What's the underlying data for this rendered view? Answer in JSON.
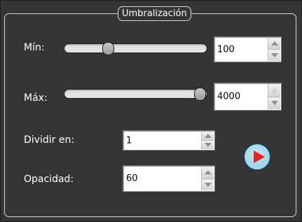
{
  "group": {
    "title": "Umbralización"
  },
  "min": {
    "label": "Mín:",
    "value": "100",
    "up_enabled": true,
    "down_enabled": true
  },
  "max": {
    "label": "Máx:",
    "value": "4000",
    "up_enabled": false,
    "down_enabled": true
  },
  "divide": {
    "label": "Dividir en:",
    "value": "1",
    "up_enabled": true,
    "down_enabled": true
  },
  "opacity": {
    "label": "Opacidad:",
    "value": "60",
    "up_enabled": true,
    "down_enabled": true
  },
  "play": {
    "icon": "play-icon",
    "color": "#e32424"
  }
}
